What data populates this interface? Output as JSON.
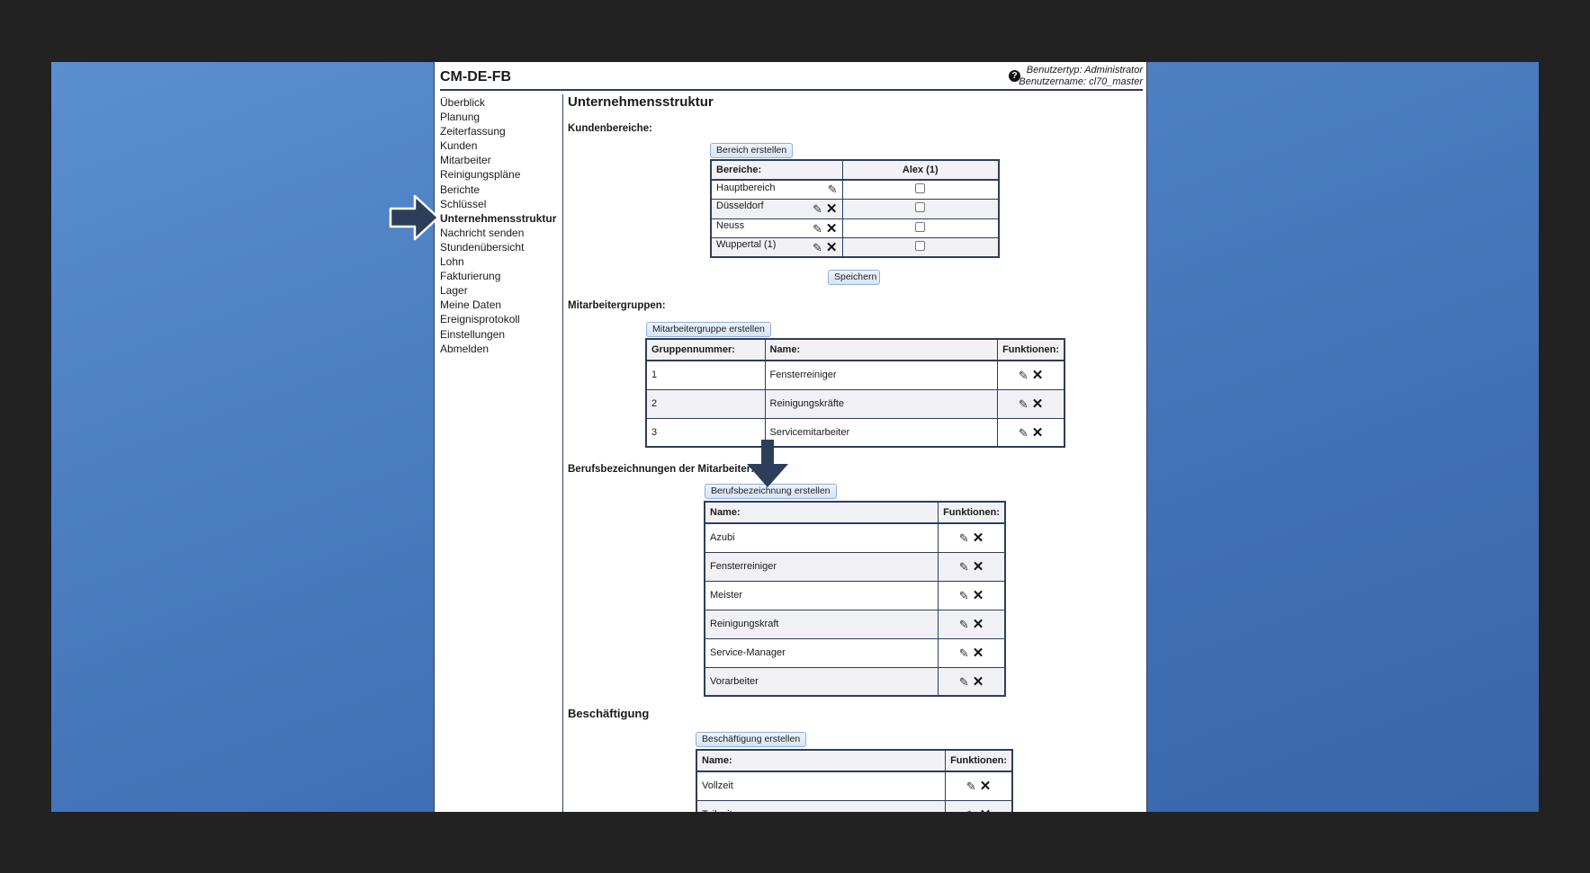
{
  "app": {
    "title": "CM-DE-FB",
    "user_type": "Benutzertyp: Administrator",
    "user_name": "Benutzername: cl70_master"
  },
  "sidebar": {
    "items": [
      {
        "label": "Überblick"
      },
      {
        "label": "Planung"
      },
      {
        "label": "Zeiterfassung"
      },
      {
        "label": "Kunden"
      },
      {
        "label": "Mitarbeiter"
      },
      {
        "label": "Reinigungspläne"
      },
      {
        "label": "Berichte"
      },
      {
        "label": "Schlüssel"
      },
      {
        "label": "Unternehmensstruktur",
        "active": true
      },
      {
        "label": "Nachricht senden"
      },
      {
        "label": "Stundenübersicht"
      },
      {
        "label": "Lohn"
      },
      {
        "label": "Fakturierung"
      },
      {
        "label": "Lager"
      },
      {
        "label": "Meine Daten"
      },
      {
        "label": "Ereignisprotokoll"
      },
      {
        "label": "Einstellungen"
      },
      {
        "label": "Abmelden"
      }
    ]
  },
  "main": {
    "title": "Unternehmensstruktur",
    "kundenbereiche": {
      "label": "Kundenbereiche:",
      "create_button": "Bereich erstellen",
      "headers": [
        "Bereiche:",
        "Alex (1)"
      ],
      "rows": [
        {
          "name": "Hauptbereich",
          "deletable": false,
          "checked": false
        },
        {
          "name": "Düsseldorf",
          "deletable": true,
          "checked": false
        },
        {
          "name": "Neuss",
          "deletable": true,
          "checked": false
        },
        {
          "name": "Wuppertal (1)",
          "deletable": true,
          "checked": false
        }
      ],
      "save_button": "Speichern"
    },
    "gruppen": {
      "label": "Mitarbeitergruppen:",
      "create_button": "Mitarbeitergruppe erstellen",
      "headers": [
        "Gruppennummer:",
        "Name:",
        "Funktionen:"
      ],
      "rows": [
        [
          "1",
          "Fensterreiniger"
        ],
        [
          "2",
          "Reinigungskräfte"
        ],
        [
          "3",
          "Servicemitarbeiter"
        ]
      ]
    },
    "berufe": {
      "label": "Berufsbezeichnungen der Mitarbeiter:",
      "create_button": "Berufsbezeichnung erstellen",
      "headers": [
        "Name:",
        "Funktionen:"
      ],
      "rows": [
        "Azubi",
        "Fensterreiniger",
        "Meister",
        "Reinigungskraft",
        "Service-Manager",
        "Vorarbeiter"
      ]
    },
    "beschaeftigung": {
      "label": "Beschäftigung",
      "create_button": "Beschäftigung erstellen",
      "headers": [
        "Name:",
        "Funktionen:"
      ],
      "rows": [
        "Vollzeit",
        "Teilzeit"
      ]
    }
  },
  "icons": {
    "edit": "pencil-icon",
    "delete": "x-icon",
    "help": "question-circle-icon",
    "annotation": "arrow-icon"
  },
  "colors": {
    "border": "#2c3e5a",
    "desktop": "#4a7cc0",
    "arrow": "#2c3e5a"
  }
}
